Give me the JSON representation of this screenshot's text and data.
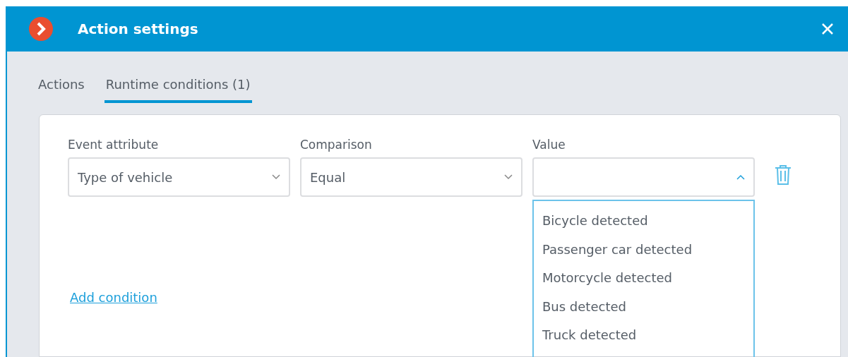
{
  "window": {
    "title": "Action settings"
  },
  "tabs": [
    {
      "label": "Actions",
      "selected": false
    },
    {
      "label": "Runtime conditions (1)",
      "selected": true
    }
  ],
  "conditions": [
    {
      "fields": [
        {
          "label": "Event attribute",
          "value": "Type of vehicle",
          "expanded": false
        },
        {
          "label": "Comparison",
          "value": "Equal",
          "expanded": false
        },
        {
          "label": "Value",
          "expanded": true,
          "options": [
            "Bicycle detected",
            "Passenger car detected",
            "Motorcycle detected",
            "Bus detected",
            "Truck detected"
          ]
        }
      ]
    }
  ],
  "add_link": "Add condition"
}
